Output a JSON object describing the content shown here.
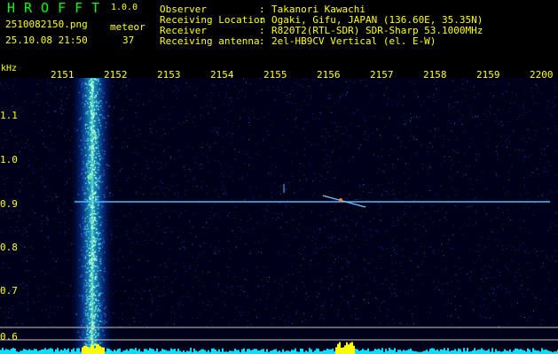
{
  "header": {
    "app_title": "HROFFT",
    "app_version": "1.0.0",
    "file_name": "2510082150.png",
    "mode_label": "meteor",
    "timestamp": "25.10.08 21:50",
    "mode_count": "37"
  },
  "info": [
    {
      "label": "Observer",
      "value": "Takanori Kawachi"
    },
    {
      "label": "Receiving Location",
      "value": "Ogaki, Gifu, JAPAN (136.60E, 35.35N)"
    },
    {
      "label": "Receiver",
      "value": "R820T2(RTL-SDR) SDR-Sharp 53.1000MHz"
    },
    {
      "label": "Receiving antenna",
      "value": "2el-HB9CV Vertical (el. E-W)"
    }
  ],
  "axes": {
    "unit": "kHz",
    "x_ticks": [
      "2151",
      "2152",
      "2153",
      "2154",
      "2155",
      "2156",
      "2157",
      "2158",
      "2159",
      "2200"
    ],
    "y_ticks": [
      "1.1",
      "1.0",
      "0.9",
      "0.8",
      "0.7",
      "0.6"
    ]
  },
  "colors": {
    "label_text": "#00ff00",
    "value_text": "#ffff00",
    "background": "#000000",
    "plot_background": "#000018",
    "noise_band": "#00ffff",
    "trace": "#40c0ff"
  }
}
